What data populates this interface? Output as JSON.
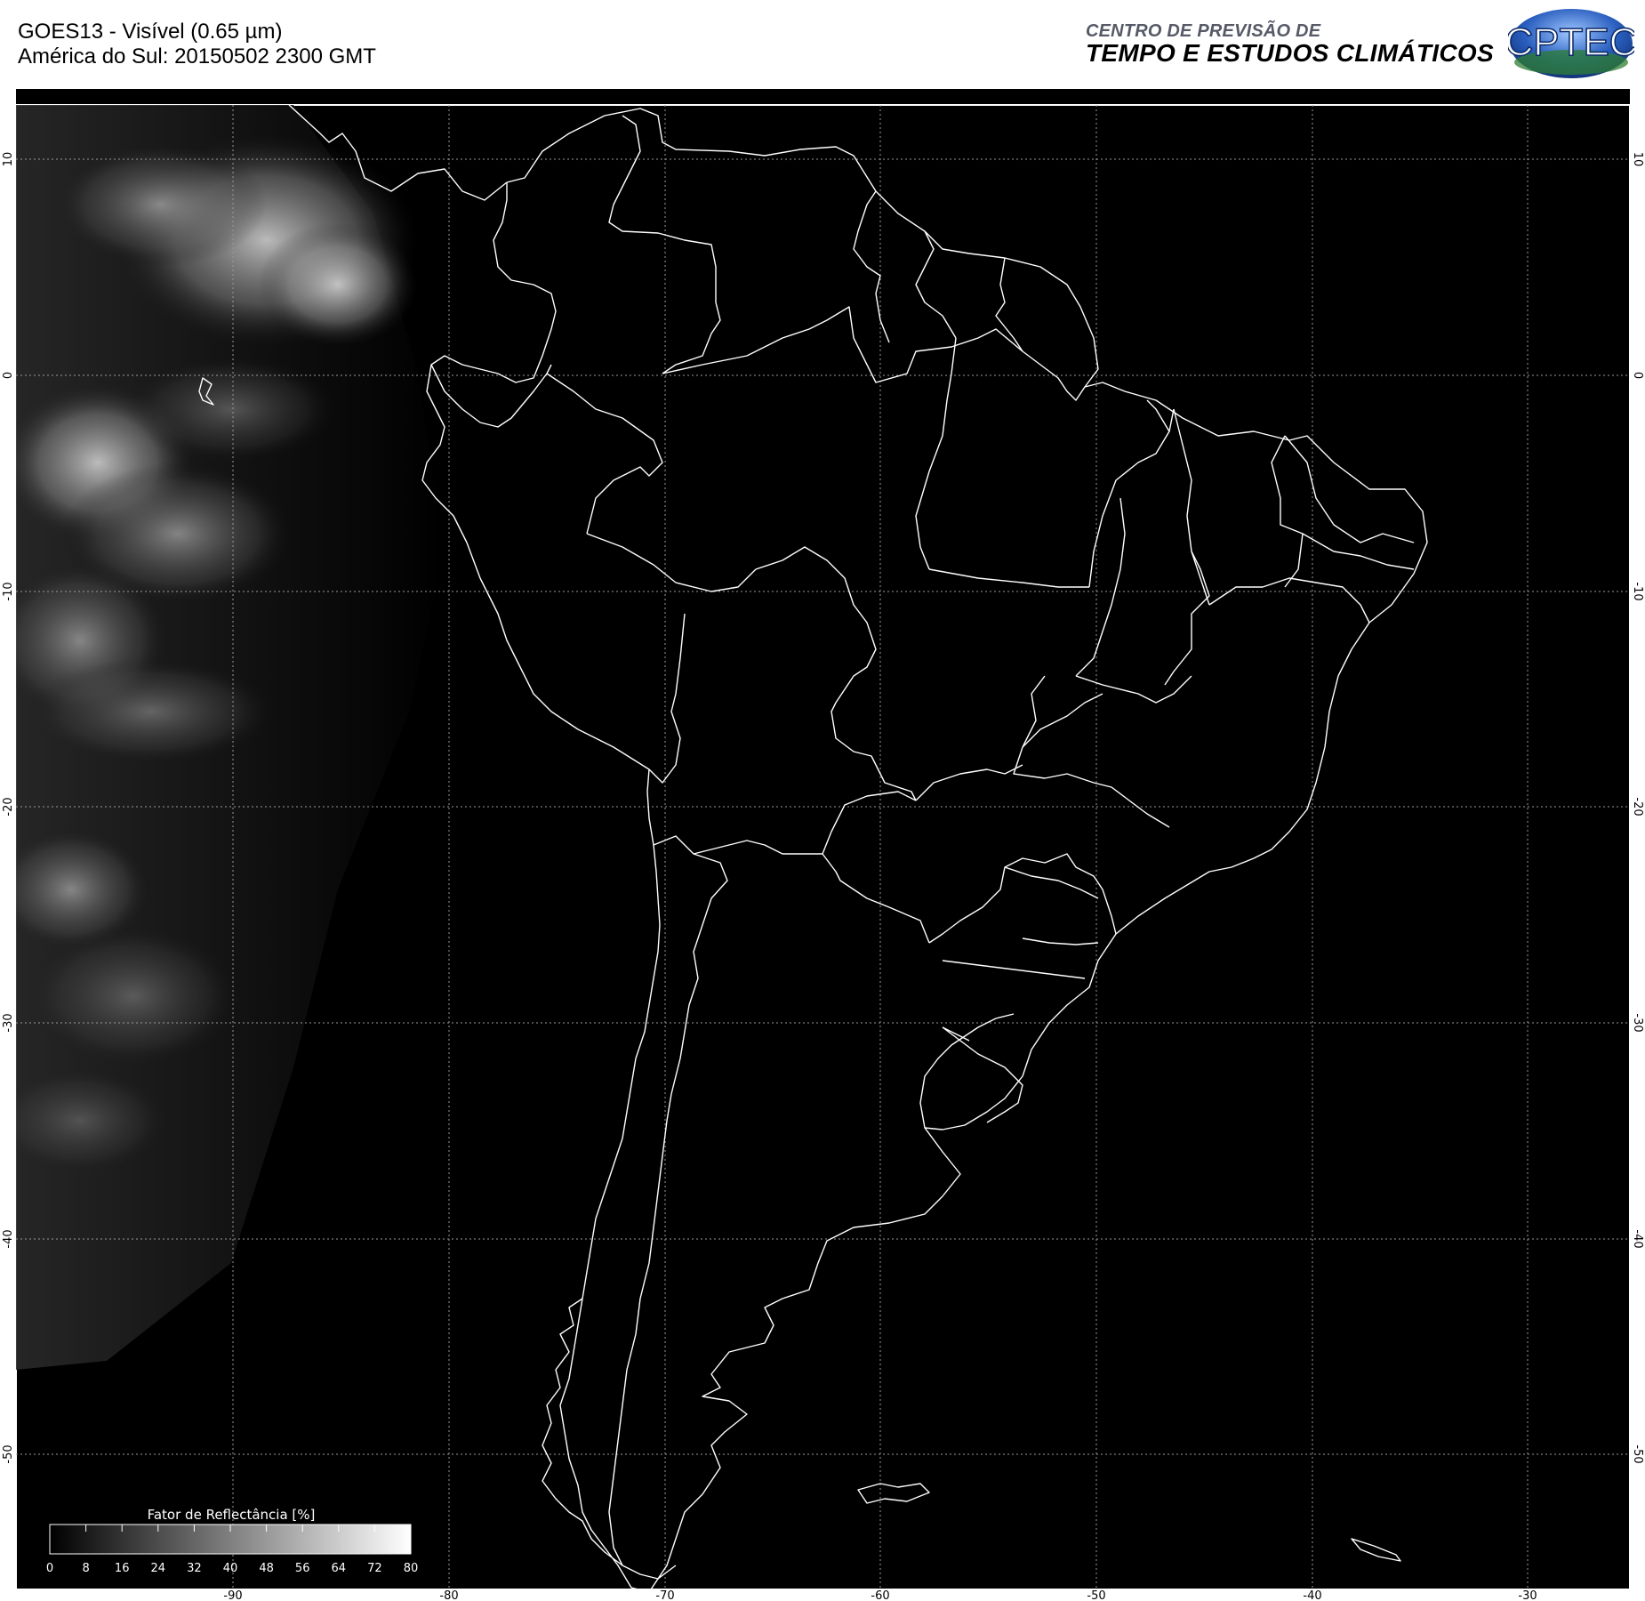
{
  "header": {
    "title_line1": "GOES13 - Visível (0.65 µm)",
    "title_line2": "América do Sul: 20150502 2300 GMT",
    "org_line1": "CENTRO DE PREVISÃO DE",
    "org_line2": "TEMPO E ESTUDOS CLIMÁTICOS",
    "logo_text": "CPTEC"
  },
  "map": {
    "background_color": "#000000",
    "coastline_color": "#ffffff",
    "longitude_ticks": [
      "-90",
      "-80",
      "-70",
      "-60",
      "-50",
      "-40",
      "-30"
    ],
    "latitude_ticks": [
      "10",
      "0",
      "-10",
      "-20",
      "-30",
      "-40",
      "-50"
    ]
  },
  "colorbar": {
    "title": "Fator de Reflectância [%]",
    "tick_labels": [
      "0",
      "8",
      "16",
      "24",
      "32",
      "40",
      "48",
      "56",
      "64",
      "72",
      "80"
    ]
  }
}
